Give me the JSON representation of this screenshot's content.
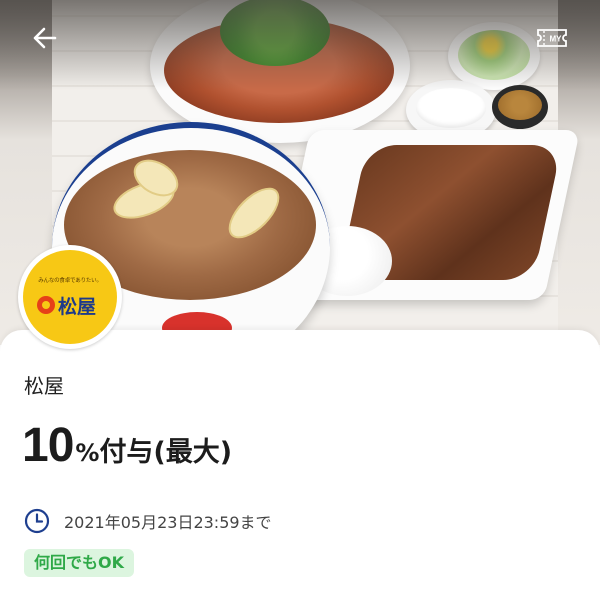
{
  "logo": {
    "tagline": "みんなの食卓でありたい。",
    "brand": "松屋"
  },
  "store": {
    "name": "松屋"
  },
  "reward": {
    "rate": "10",
    "percent_sign": "%",
    "suffix": "付与(最大)"
  },
  "deadline": {
    "text": "2021年05月23日23:59まで"
  },
  "badge": {
    "label": "何回でもOK"
  },
  "topbar": {
    "ticket_icon_text": "MY"
  },
  "colors": {
    "badge_bg": "#dcf5df",
    "badge_text": "#2fa948",
    "logo_yellow": "#f7c815",
    "logo_blue": "#1e3a8a"
  },
  "icons": {
    "back": "back-arrow-icon",
    "ticket": "my-ticket-icon",
    "clock": "clock-icon"
  }
}
